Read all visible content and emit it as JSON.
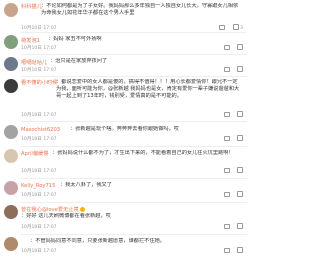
{
  "comments": [
    {
      "name": "科科猫儿",
      "text": "：不论如何都是为了子女好。我妈妈那么多年独自一人独自女儿长大，守寡跟女儿相依为命我女儿如花年华子都在这个男人手里",
      "time": "10月10日 17:07",
      "avatar_color": "#c9a48d",
      "likes": "3",
      "replies": ""
    },
    {
      "name": "荷发泡1",
      "text": "：妈妈 家丑不可外扬啊",
      "time": "10月10日 17:07",
      "avatar_color": "#7fa07a",
      "likes": "",
      "replies": ""
    },
    {
      "name": "噶噶哒咕儿",
      "text": "：治只是在家放弃孩问了",
      "time": "10月10日 17:07",
      "avatar_color": "#6b7b8c",
      "likes": "",
      "replies": ""
    },
    {
      "name": "看不懂的小时候",
      "text": "：都说恋爱中的女人都是傻的，搞得不值得！！！用心长都爱情你！跟兄不一定为我，面听可能为你，@张新越 我妈妈也是女，肯定有爱你一辈子嫌说爸爸和大哥一起上到了13年时，钱别受，爱情真的是不可能的。",
      "mention": "@张新越",
      "time": "10月10日 17:07",
      "avatar_color": "#3a3a3a",
      "likes": "",
      "replies": ""
    },
    {
      "name": "Masochist6203",
      "text": "：张新越是玩个啥。奔奔奔去看你跟她做吗，哎",
      "time": "10月10日 17:07",
      "avatar_color": "#a3a3a3",
      "likes": "",
      "replies": ""
    },
    {
      "name": "April偏缓慢",
      "text": "：张妈妈说什么都不为了，才生出下来的，不能看着自己的女儿往火坑里跳啊！",
      "time": "10月10日 17:07",
      "avatar_color": "#d8c7b0",
      "likes": "",
      "replies": ""
    },
    {
      "name": "Kelly_Roy715",
      "text": "：我太八卦了，我又了",
      "time": "10月10日 17:07",
      "avatar_color": "#c7a3a8",
      "likes": "",
      "replies": ""
    },
    {
      "name": "曾在我心@love爱无止境",
      "text": "：好好 这几天刷微博都在看张新越，哎",
      "time": "10月10日 17:07",
      "avatar_color": "#8c6e5a",
      "likes": "",
      "replies": ""
    },
    {
      "name": "",
      "text": "：不管妈妈同意不同意，只要张新越愿意，谁都拦不住她。",
      "time": "10月10日 17:07",
      "avatar_color": "#b08a6a",
      "likes": "",
      "replies": ""
    }
  ],
  "ui": {
    "like_icon": "like-icon",
    "reply_icon": "reply-icon",
    "badge_color": "#f4b400",
    "name_color": "#eb7350"
  }
}
